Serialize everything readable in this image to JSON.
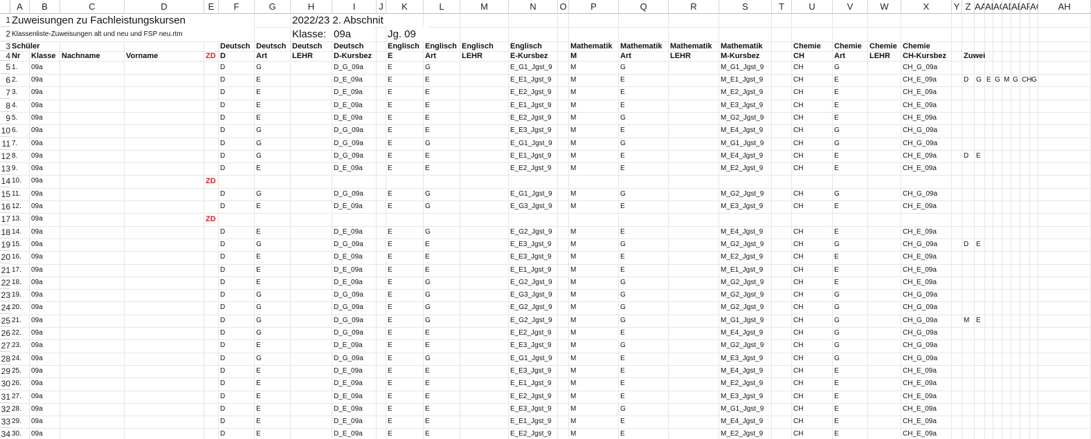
{
  "columns": [
    "A",
    "B",
    "C",
    "D",
    "E",
    "F",
    "G",
    "H",
    "I",
    "J",
    "K",
    "L",
    "M",
    "N",
    "O",
    "P",
    "Q",
    "R",
    "S",
    "T",
    "U",
    "V",
    "W",
    "X",
    "Y",
    "Z",
    "AA",
    "AB",
    "AC",
    "AD",
    "AE",
    "AF",
    "AG",
    "AH"
  ],
  "row_numbers": [
    "1",
    "2",
    "3",
    "4",
    "5",
    "6",
    "7",
    "8",
    "9",
    "10",
    "11",
    "12",
    "13",
    "14",
    "15",
    "16",
    "17",
    "18",
    "19",
    "20",
    "21",
    "22",
    "23",
    "24",
    "25",
    "26",
    "27",
    "28",
    "29",
    "30",
    "31",
    "32",
    "33",
    "34"
  ],
  "header": {
    "title": "Zuweisungen zu Fachleistungskursen",
    "subtitle": "Klassenliste-Zuweisungen alt und neu und FSP neu.rtm",
    "period": "2022/23 2. Abschnit",
    "klasse_label": "Klasse:",
    "klasse_value": "09a",
    "jg": "Jg. 09"
  },
  "group_headers": {
    "schueler": "Schüler",
    "deutsch": "Deutsch",
    "englisch": "Englisch",
    "mathematik": "Mathematik",
    "chemie": "Chemie"
  },
  "col_headers": {
    "nr": "Nr",
    "klasse": "Klasse",
    "nachname": "Nachname",
    "vorname": "Vorname",
    "zd": "ZD",
    "d": "D",
    "art": "Art",
    "lehr": "LEHR",
    "d_kursbez": "D-Kursbez",
    "e": "E",
    "e_kursbez": "E-Kursbez",
    "m": "M",
    "m_kursbez": "M-Kursbez",
    "ch": "CH",
    "ch_kursbez": "CH-Kursbez",
    "zuwei": "Zuwei"
  },
  "rows": [
    {
      "nr": "1.",
      "kl": "09a",
      "zd": "",
      "d": "D",
      "dart": "G",
      "dk": "D_G_09a",
      "e": "E",
      "eart": "G",
      "ek": "E_G1_Jgst_9",
      "m": "M",
      "mart": "G",
      "mk": "M_G1_Jgst_9",
      "ch": "CH",
      "chart": "G",
      "chk": "CH_G_09a",
      "zuw": []
    },
    {
      "nr": "2.",
      "kl": "09a",
      "zd": "",
      "d": "D",
      "dart": "E",
      "dk": "D_E_09a",
      "e": "E",
      "eart": "E",
      "ek": "E_E1_Jgst_9",
      "m": "M",
      "mart": "E",
      "mk": "M_E1_Jgst_9",
      "ch": "CH",
      "chart": "E",
      "chk": "CH_E_09a",
      "zuw": [
        "D",
        "G",
        "E",
        "G",
        "M",
        "G",
        "CH",
        "G"
      ]
    },
    {
      "nr": "3.",
      "kl": "09a",
      "zd": "",
      "d": "D",
      "dart": "E",
      "dk": "D_E_09a",
      "e": "E",
      "eart": "E",
      "ek": "E_E2_Jgst_9",
      "m": "M",
      "mart": "E",
      "mk": "M_E2_Jgst_9",
      "ch": "CH",
      "chart": "E",
      "chk": "CH_E_09a",
      "zuw": []
    },
    {
      "nr": "4.",
      "kl": "09a",
      "zd": "",
      "d": "D",
      "dart": "E",
      "dk": "D_E_09a",
      "e": "E",
      "eart": "E",
      "ek": "E_E1_Jgst_9",
      "m": "M",
      "mart": "E",
      "mk": "M_E3_Jgst_9",
      "ch": "CH",
      "chart": "E",
      "chk": "CH_E_09a",
      "zuw": []
    },
    {
      "nr": "5.",
      "kl": "09a",
      "zd": "",
      "d": "D",
      "dart": "E",
      "dk": "D_E_09a",
      "e": "E",
      "eart": "E",
      "ek": "E_E2_Jgst_9",
      "m": "M",
      "mart": "G",
      "mk": "M_G2_Jgst_9",
      "ch": "CH",
      "chart": "E",
      "chk": "CH_E_09a",
      "zuw": []
    },
    {
      "nr": "6.",
      "kl": "09a",
      "zd": "",
      "d": "D",
      "dart": "G",
      "dk": "D_G_09a",
      "e": "E",
      "eart": "E",
      "ek": "E_E3_Jgst_9",
      "m": "M",
      "mart": "E",
      "mk": "M_E4_Jgst_9",
      "ch": "CH",
      "chart": "G",
      "chk": "CH_G_09a",
      "zuw": []
    },
    {
      "nr": "7.",
      "kl": "09a",
      "zd": "",
      "d": "D",
      "dart": "G",
      "dk": "D_G_09a",
      "e": "E",
      "eart": "G",
      "ek": "E_G1_Jgst_9",
      "m": "M",
      "mart": "G",
      "mk": "M_G1_Jgst_9",
      "ch": "CH",
      "chart": "G",
      "chk": "CH_G_09a",
      "zuw": []
    },
    {
      "nr": "8.",
      "kl": "09a",
      "zd": "",
      "d": "D",
      "dart": "G",
      "dk": "D_G_09a",
      "e": "E",
      "eart": "E",
      "ek": "E_E1_Jgst_9",
      "m": "M",
      "mart": "E",
      "mk": "M_E4_Jgst_9",
      "ch": "CH",
      "chart": "E",
      "chk": "CH_E_09a",
      "zuw": [
        "D",
        "E"
      ]
    },
    {
      "nr": "9.",
      "kl": "09a",
      "zd": "",
      "d": "D",
      "dart": "E",
      "dk": "D_E_09a",
      "e": "E",
      "eart": "E",
      "ek": "E_E2_Jgst_9",
      "m": "M",
      "mart": "E",
      "mk": "M_E2_Jgst_9",
      "ch": "CH",
      "chart": "E",
      "chk": "CH_E_09a",
      "zuw": []
    },
    {
      "nr": "10.",
      "kl": "09a",
      "zd": "ZD",
      "d": "",
      "dart": "",
      "dk": "",
      "e": "",
      "eart": "",
      "ek": "",
      "m": "",
      "mart": "",
      "mk": "",
      "ch": "",
      "chart": "",
      "chk": "",
      "zuw": []
    },
    {
      "nr": "11.",
      "kl": "09a",
      "zd": "",
      "d": "D",
      "dart": "G",
      "dk": "D_G_09a",
      "e": "E",
      "eart": "G",
      "ek": "E_G1_Jgst_9",
      "m": "M",
      "mart": "G",
      "mk": "M_G2_Jgst_9",
      "ch": "CH",
      "chart": "G",
      "chk": "CH_G_09a",
      "zuw": []
    },
    {
      "nr": "12.",
      "kl": "09a",
      "zd": "",
      "d": "D",
      "dart": "E",
      "dk": "D_E_09a",
      "e": "E",
      "eart": "G",
      "ek": "E_G3_Jgst_9",
      "m": "M",
      "mart": "E",
      "mk": "M_E3_Jgst_9",
      "ch": "CH",
      "chart": "E",
      "chk": "CH_E_09a",
      "zuw": []
    },
    {
      "nr": "13.",
      "kl": "09a",
      "zd": "ZD",
      "d": "",
      "dart": "",
      "dk": "",
      "e": "",
      "eart": "",
      "ek": "",
      "m": "",
      "mart": "",
      "mk": "",
      "ch": "",
      "chart": "",
      "chk": "",
      "zuw": []
    },
    {
      "nr": "14.",
      "kl": "09a",
      "zd": "",
      "d": "D",
      "dart": "E",
      "dk": "D_E_09a",
      "e": "E",
      "eart": "G",
      "ek": "E_G2_Jgst_9",
      "m": "M",
      "mart": "E",
      "mk": "M_E4_Jgst_9",
      "ch": "CH",
      "chart": "E",
      "chk": "CH_E_09a",
      "zuw": []
    },
    {
      "nr": "15.",
      "kl": "09a",
      "zd": "",
      "d": "D",
      "dart": "G",
      "dk": "D_G_09a",
      "e": "E",
      "eart": "E",
      "ek": "E_E3_Jgst_9",
      "m": "M",
      "mart": "G",
      "mk": "M_G2_Jgst_9",
      "ch": "CH",
      "chart": "G",
      "chk": "CH_G_09a",
      "zuw": [
        "D",
        "E"
      ]
    },
    {
      "nr": "16.",
      "kl": "09a",
      "zd": "",
      "d": "D",
      "dart": "E",
      "dk": "D_E_09a",
      "e": "E",
      "eart": "E",
      "ek": "E_E3_Jgst_9",
      "m": "M",
      "mart": "E",
      "mk": "M_E2_Jgst_9",
      "ch": "CH",
      "chart": "E",
      "chk": "CH_E_09a",
      "zuw": []
    },
    {
      "nr": "17.",
      "kl": "09a",
      "zd": "",
      "d": "D",
      "dart": "E",
      "dk": "D_E_09a",
      "e": "E",
      "eart": "E",
      "ek": "E_E1_Jgst_9",
      "m": "M",
      "mart": "E",
      "mk": "M_E1_Jgst_9",
      "ch": "CH",
      "chart": "E",
      "chk": "CH_E_09a",
      "zuw": []
    },
    {
      "nr": "18.",
      "kl": "09a",
      "zd": "",
      "d": "D",
      "dart": "E",
      "dk": "D_E_09a",
      "e": "E",
      "eart": "G",
      "ek": "E_G2_Jgst_9",
      "m": "M",
      "mart": "G",
      "mk": "M_G2_Jgst_9",
      "ch": "CH",
      "chart": "E",
      "chk": "CH_E_09a",
      "zuw": []
    },
    {
      "nr": "19.",
      "kl": "09a",
      "zd": "",
      "d": "D",
      "dart": "G",
      "dk": "D_G_09a",
      "e": "E",
      "eart": "G",
      "ek": "E_G3_Jgst_9",
      "m": "M",
      "mart": "G",
      "mk": "M_G2_Jgst_9",
      "ch": "CH",
      "chart": "G",
      "chk": "CH_G_09a",
      "zuw": []
    },
    {
      "nr": "20.",
      "kl": "09a",
      "zd": "",
      "d": "D",
      "dart": "G",
      "dk": "D_G_09a",
      "e": "E",
      "eart": "G",
      "ek": "E_G2_Jgst_9",
      "m": "M",
      "mart": "G",
      "mk": "M_G2_Jgst_9",
      "ch": "CH",
      "chart": "G",
      "chk": "CH_G_09a",
      "zuw": []
    },
    {
      "nr": "21.",
      "kl": "09a",
      "zd": "",
      "d": "D",
      "dart": "G",
      "dk": "D_G_09a",
      "e": "E",
      "eart": "G",
      "ek": "E_G2_Jgst_9",
      "m": "M",
      "mart": "G",
      "mk": "M_G1_Jgst_9",
      "ch": "CH",
      "chart": "G",
      "chk": "CH_G_09a",
      "zuw": [
        "M",
        "E"
      ]
    },
    {
      "nr": "22.",
      "kl": "09a",
      "zd": "",
      "d": "D",
      "dart": "G",
      "dk": "D_G_09a",
      "e": "E",
      "eart": "E",
      "ek": "E_E2_Jgst_9",
      "m": "M",
      "mart": "E",
      "mk": "M_E4_Jgst_9",
      "ch": "CH",
      "chart": "G",
      "chk": "CH_G_09a",
      "zuw": []
    },
    {
      "nr": "23.",
      "kl": "09a",
      "zd": "",
      "d": "D",
      "dart": "E",
      "dk": "D_E_09a",
      "e": "E",
      "eart": "E",
      "ek": "E_E3_Jgst_9",
      "m": "M",
      "mart": "G",
      "mk": "M_G2_Jgst_9",
      "ch": "CH",
      "chart": "G",
      "chk": "CH_G_09a",
      "zuw": []
    },
    {
      "nr": "24.",
      "kl": "09a",
      "zd": "",
      "d": "D",
      "dart": "G",
      "dk": "D_G_09a",
      "e": "E",
      "eart": "G",
      "ek": "E_G1_Jgst_9",
      "m": "M",
      "mart": "E",
      "mk": "M_E3_Jgst_9",
      "ch": "CH",
      "chart": "G",
      "chk": "CH_G_09a",
      "zuw": []
    },
    {
      "nr": "25.",
      "kl": "09a",
      "zd": "",
      "d": "D",
      "dart": "E",
      "dk": "D_E_09a",
      "e": "E",
      "eart": "E",
      "ek": "E_E3_Jgst_9",
      "m": "M",
      "mart": "E",
      "mk": "M_E4_Jgst_9",
      "ch": "CH",
      "chart": "E",
      "chk": "CH_E_09a",
      "zuw": []
    },
    {
      "nr": "26.",
      "kl": "09a",
      "zd": "",
      "d": "D",
      "dart": "E",
      "dk": "D_E_09a",
      "e": "E",
      "eart": "E",
      "ek": "E_E1_Jgst_9",
      "m": "M",
      "mart": "E",
      "mk": "M_E2_Jgst_9",
      "ch": "CH",
      "chart": "E",
      "chk": "CH_E_09a",
      "zuw": []
    },
    {
      "nr": "27.",
      "kl": "09a",
      "zd": "",
      "d": "D",
      "dart": "E",
      "dk": "D_E_09a",
      "e": "E",
      "eart": "E",
      "ek": "E_E2_Jgst_9",
      "m": "M",
      "mart": "E",
      "mk": "M_E3_Jgst_9",
      "ch": "CH",
      "chart": "E",
      "chk": "CH_E_09a",
      "zuw": []
    },
    {
      "nr": "28.",
      "kl": "09a",
      "zd": "",
      "d": "D",
      "dart": "E",
      "dk": "D_E_09a",
      "e": "E",
      "eart": "E",
      "ek": "E_E3_Jgst_9",
      "m": "M",
      "mart": "G",
      "mk": "M_G1_Jgst_9",
      "ch": "CH",
      "chart": "E",
      "chk": "CH_E_09a",
      "zuw": []
    },
    {
      "nr": "29.",
      "kl": "09a",
      "zd": "",
      "d": "D",
      "dart": "E",
      "dk": "D_E_09a",
      "e": "E",
      "eart": "E",
      "ek": "E_E1_Jgst_9",
      "m": "M",
      "mart": "E",
      "mk": "M_E4_Jgst_9",
      "ch": "CH",
      "chart": "E",
      "chk": "CH_E_09a",
      "zuw": []
    },
    {
      "nr": "30.",
      "kl": "09a",
      "zd": "",
      "d": "D",
      "dart": "E",
      "dk": "D_E_09a",
      "e": "E",
      "eart": "E",
      "ek": "E_E2_Jgst_9",
      "m": "M",
      "mart": "E",
      "mk": "M_E2_Jgst_9",
      "ch": "CH",
      "chart": "E",
      "chk": "CH_E_09a",
      "zuw": []
    }
  ]
}
